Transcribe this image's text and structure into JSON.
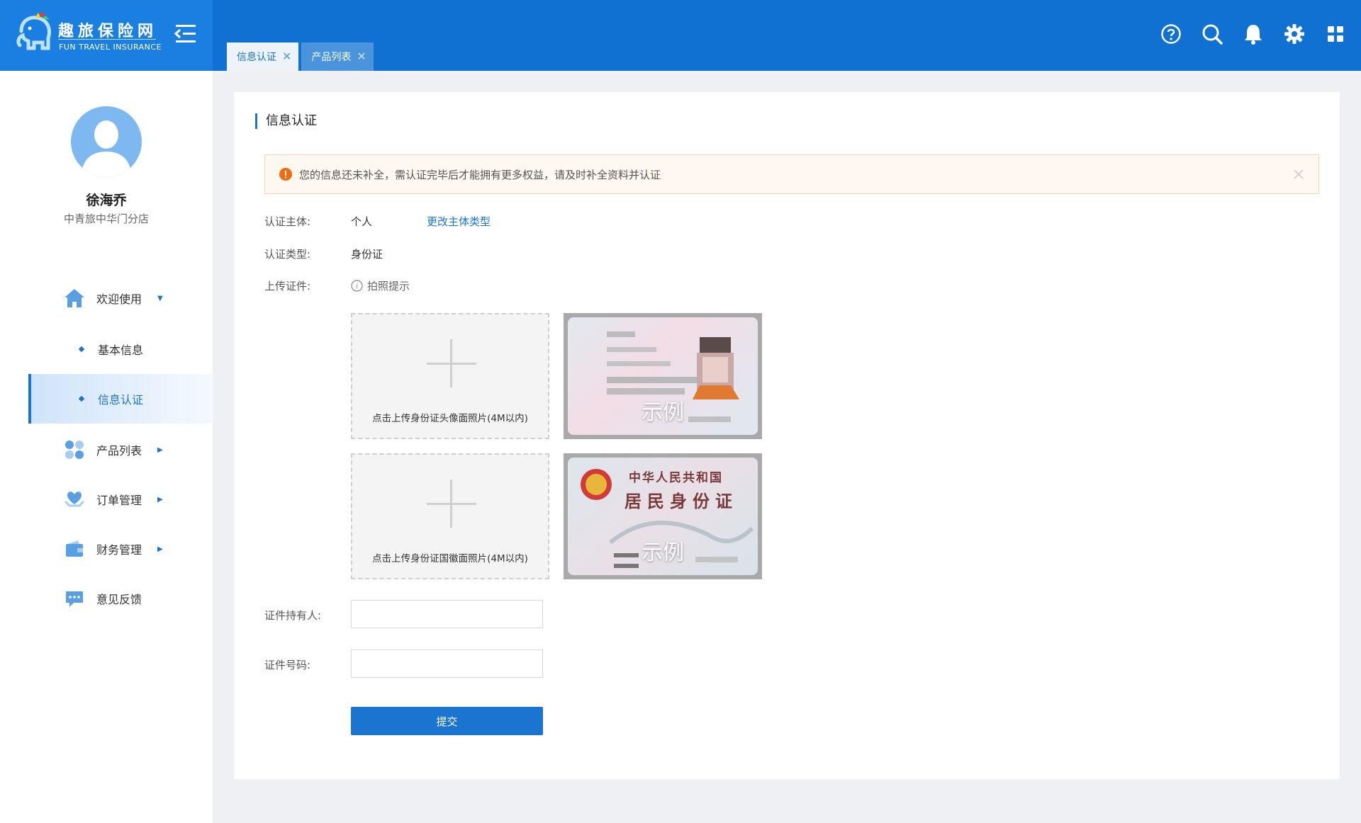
{
  "header": {
    "logo_cn": "趣旅保险网",
    "logo_en": "FUN TRAVEL INSURANCE",
    "tabs": [
      {
        "label": "信息认证",
        "active": true
      },
      {
        "label": "产品列表",
        "active": false
      }
    ],
    "icons": [
      "help-icon",
      "search-icon",
      "bell-icon",
      "gear-icon",
      "apps-grid-icon"
    ]
  },
  "sidebar": {
    "user_name": "徐海乔",
    "store": "中青旅中华门分店",
    "items": [
      {
        "label": "欢迎使用",
        "icon": "home-icon",
        "expanded": true
      },
      {
        "label": "基本信息",
        "sub": true
      },
      {
        "label": "信息认证",
        "sub": true,
        "active": true
      },
      {
        "label": "产品列表",
        "icon": "products-icon"
      },
      {
        "label": "订单管理",
        "icon": "order-icon"
      },
      {
        "label": "财务管理",
        "icon": "wallet-icon"
      },
      {
        "label": "意见反馈",
        "icon": "feedback-icon"
      }
    ]
  },
  "main": {
    "title": "信息认证",
    "alert": "您的信息还未补全，需认证完毕后才能拥有更多权益，请及时补全资料并认证",
    "subject_label": "认证主体:",
    "subject_value": "个人",
    "change_link": "更改主体类型",
    "type_label": "认证类型:",
    "type_value": "身份证",
    "upload_label": "上传证件:",
    "photo_tip": "拍照提示",
    "upload_front": "点击上传身份证头像面照片(4M以内)",
    "upload_back": "点击上传身份证国徽面照片(4M以内)",
    "example_label": "示例",
    "id_back_line1": "中华人民共和国",
    "id_back_line2": "居民身份证",
    "holder_label": "证件持有人:",
    "holder_value": "",
    "number_label": "证件号码:",
    "number_value": "",
    "submit": "提交"
  },
  "colors": {
    "primary": "#1071d2",
    "accent": "#1a74d0",
    "alert_bg": "#fff8f0",
    "alert_icon": "#f06a0f"
  }
}
